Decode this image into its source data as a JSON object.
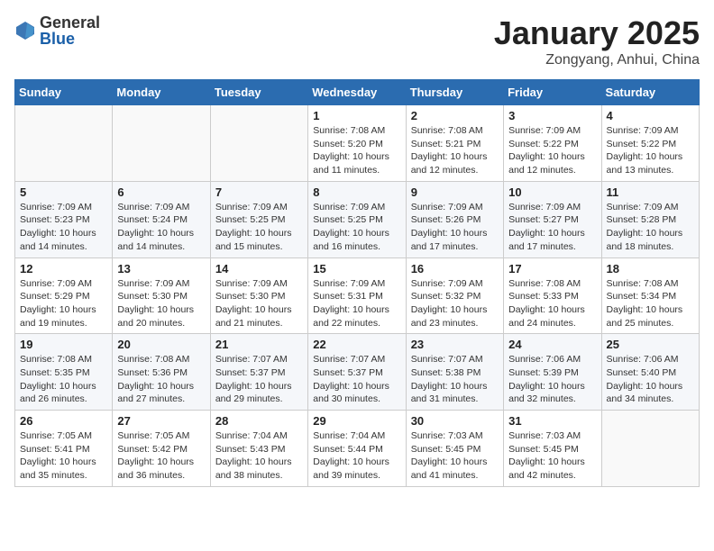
{
  "logo": {
    "general": "General",
    "blue": "Blue"
  },
  "header": {
    "title": "January 2025",
    "location": "Zongyang, Anhui, China"
  },
  "weekdays": [
    "Sunday",
    "Monday",
    "Tuesday",
    "Wednesday",
    "Thursday",
    "Friday",
    "Saturday"
  ],
  "weeks": [
    [
      {
        "day": "",
        "info": ""
      },
      {
        "day": "",
        "info": ""
      },
      {
        "day": "",
        "info": ""
      },
      {
        "day": "1",
        "info": "Sunrise: 7:08 AM\nSunset: 5:20 PM\nDaylight: 10 hours\nand 11 minutes."
      },
      {
        "day": "2",
        "info": "Sunrise: 7:08 AM\nSunset: 5:21 PM\nDaylight: 10 hours\nand 12 minutes."
      },
      {
        "day": "3",
        "info": "Sunrise: 7:09 AM\nSunset: 5:22 PM\nDaylight: 10 hours\nand 12 minutes."
      },
      {
        "day": "4",
        "info": "Sunrise: 7:09 AM\nSunset: 5:22 PM\nDaylight: 10 hours\nand 13 minutes."
      }
    ],
    [
      {
        "day": "5",
        "info": "Sunrise: 7:09 AM\nSunset: 5:23 PM\nDaylight: 10 hours\nand 14 minutes."
      },
      {
        "day": "6",
        "info": "Sunrise: 7:09 AM\nSunset: 5:24 PM\nDaylight: 10 hours\nand 14 minutes."
      },
      {
        "day": "7",
        "info": "Sunrise: 7:09 AM\nSunset: 5:25 PM\nDaylight: 10 hours\nand 15 minutes."
      },
      {
        "day": "8",
        "info": "Sunrise: 7:09 AM\nSunset: 5:25 PM\nDaylight: 10 hours\nand 16 minutes."
      },
      {
        "day": "9",
        "info": "Sunrise: 7:09 AM\nSunset: 5:26 PM\nDaylight: 10 hours\nand 17 minutes."
      },
      {
        "day": "10",
        "info": "Sunrise: 7:09 AM\nSunset: 5:27 PM\nDaylight: 10 hours\nand 17 minutes."
      },
      {
        "day": "11",
        "info": "Sunrise: 7:09 AM\nSunset: 5:28 PM\nDaylight: 10 hours\nand 18 minutes."
      }
    ],
    [
      {
        "day": "12",
        "info": "Sunrise: 7:09 AM\nSunset: 5:29 PM\nDaylight: 10 hours\nand 19 minutes."
      },
      {
        "day": "13",
        "info": "Sunrise: 7:09 AM\nSunset: 5:30 PM\nDaylight: 10 hours\nand 20 minutes."
      },
      {
        "day": "14",
        "info": "Sunrise: 7:09 AM\nSunset: 5:30 PM\nDaylight: 10 hours\nand 21 minutes."
      },
      {
        "day": "15",
        "info": "Sunrise: 7:09 AM\nSunset: 5:31 PM\nDaylight: 10 hours\nand 22 minutes."
      },
      {
        "day": "16",
        "info": "Sunrise: 7:09 AM\nSunset: 5:32 PM\nDaylight: 10 hours\nand 23 minutes."
      },
      {
        "day": "17",
        "info": "Sunrise: 7:08 AM\nSunset: 5:33 PM\nDaylight: 10 hours\nand 24 minutes."
      },
      {
        "day": "18",
        "info": "Sunrise: 7:08 AM\nSunset: 5:34 PM\nDaylight: 10 hours\nand 25 minutes."
      }
    ],
    [
      {
        "day": "19",
        "info": "Sunrise: 7:08 AM\nSunset: 5:35 PM\nDaylight: 10 hours\nand 26 minutes."
      },
      {
        "day": "20",
        "info": "Sunrise: 7:08 AM\nSunset: 5:36 PM\nDaylight: 10 hours\nand 27 minutes."
      },
      {
        "day": "21",
        "info": "Sunrise: 7:07 AM\nSunset: 5:37 PM\nDaylight: 10 hours\nand 29 minutes."
      },
      {
        "day": "22",
        "info": "Sunrise: 7:07 AM\nSunset: 5:37 PM\nDaylight: 10 hours\nand 30 minutes."
      },
      {
        "day": "23",
        "info": "Sunrise: 7:07 AM\nSunset: 5:38 PM\nDaylight: 10 hours\nand 31 minutes."
      },
      {
        "day": "24",
        "info": "Sunrise: 7:06 AM\nSunset: 5:39 PM\nDaylight: 10 hours\nand 32 minutes."
      },
      {
        "day": "25",
        "info": "Sunrise: 7:06 AM\nSunset: 5:40 PM\nDaylight: 10 hours\nand 34 minutes."
      }
    ],
    [
      {
        "day": "26",
        "info": "Sunrise: 7:05 AM\nSunset: 5:41 PM\nDaylight: 10 hours\nand 35 minutes."
      },
      {
        "day": "27",
        "info": "Sunrise: 7:05 AM\nSunset: 5:42 PM\nDaylight: 10 hours\nand 36 minutes."
      },
      {
        "day": "28",
        "info": "Sunrise: 7:04 AM\nSunset: 5:43 PM\nDaylight: 10 hours\nand 38 minutes."
      },
      {
        "day": "29",
        "info": "Sunrise: 7:04 AM\nSunset: 5:44 PM\nDaylight: 10 hours\nand 39 minutes."
      },
      {
        "day": "30",
        "info": "Sunrise: 7:03 AM\nSunset: 5:45 PM\nDaylight: 10 hours\nand 41 minutes."
      },
      {
        "day": "31",
        "info": "Sunrise: 7:03 AM\nSunset: 5:45 PM\nDaylight: 10 hours\nand 42 minutes."
      },
      {
        "day": "",
        "info": ""
      }
    ]
  ]
}
